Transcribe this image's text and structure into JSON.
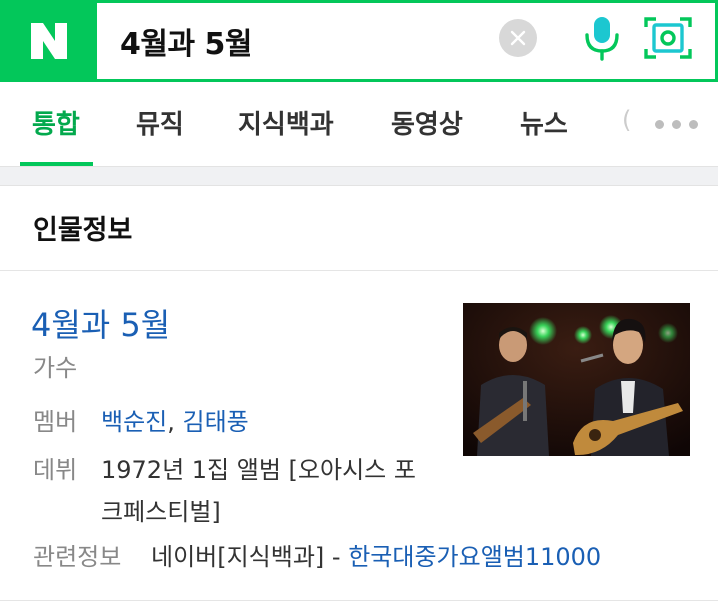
{
  "search": {
    "logo_letter": "N",
    "query": "4월과 5월",
    "brand_color": "#03c75a"
  },
  "icons": [
    "n-logo-icon",
    "clear-icon",
    "mic-icon",
    "lens-icon",
    "more-icon"
  ],
  "tabs": [
    {
      "label": "통합",
      "active": true
    },
    {
      "label": "뮤직"
    },
    {
      "label": "지식백과"
    },
    {
      "label": "동영상"
    },
    {
      "label": "뉴스"
    }
  ],
  "section": {
    "title": "인물정보"
  },
  "person": {
    "name": "4월과 5월",
    "role": "가수",
    "member_label": "멤버",
    "members": [
      "백순진",
      "김태풍"
    ],
    "member_separator": ", ",
    "debut_label": "데뷔",
    "debut_line1": "1972년 1집 앨범 [오아시스 포",
    "debut_line2": "크페스티벌]",
    "related_label": "관련정보",
    "related_source": "네이버[지식백과] - ",
    "related_link": "한국대중가요앨범11000",
    "photo": "two-singers-photo"
  }
}
